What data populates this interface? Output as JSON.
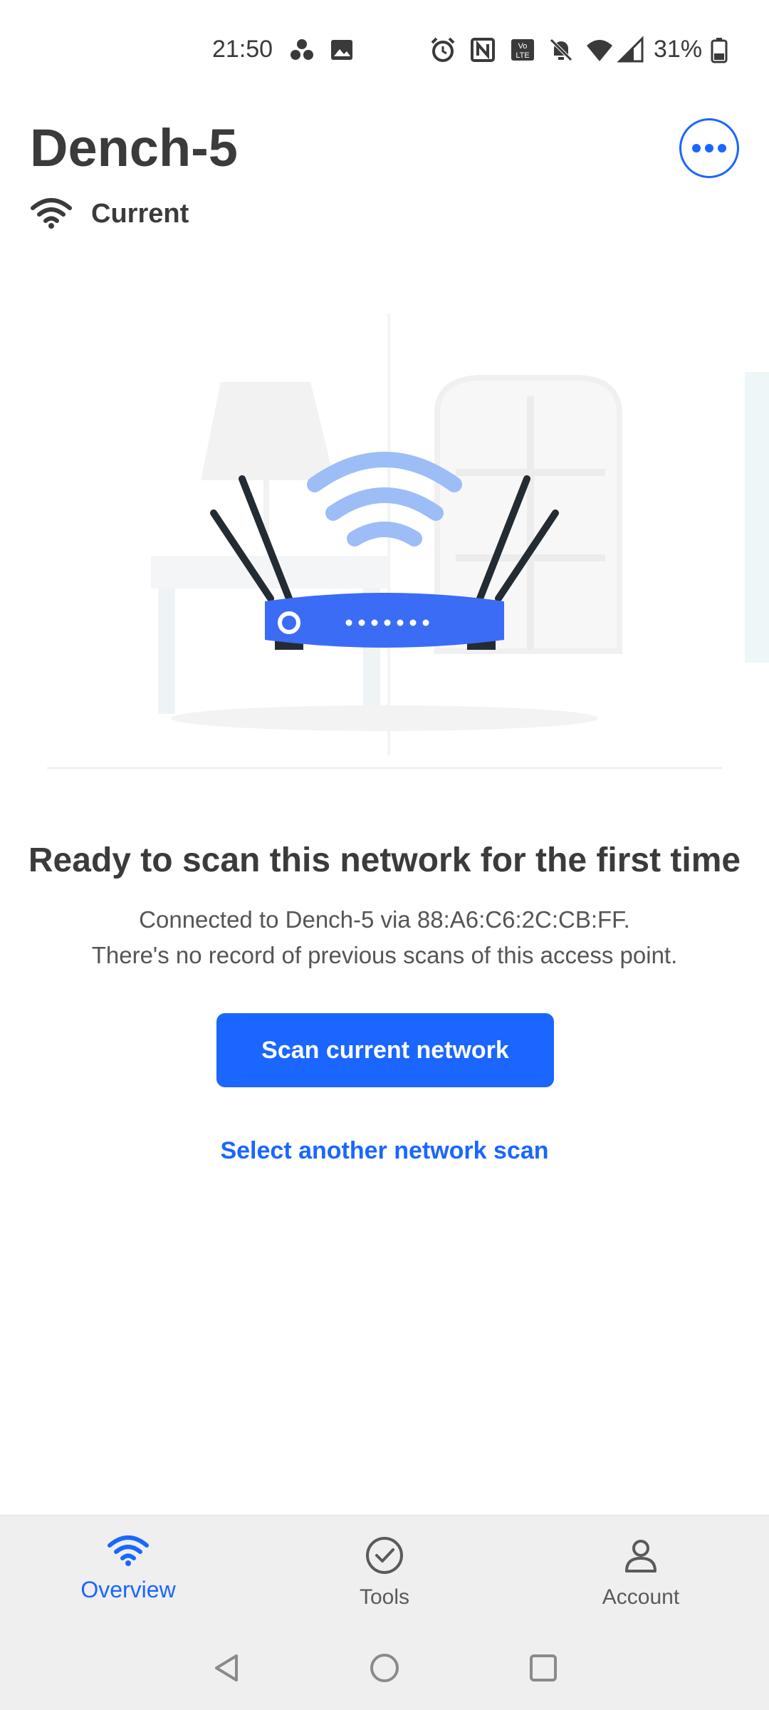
{
  "status_bar": {
    "time": "21:50",
    "battery": "31%",
    "icons": [
      "people-icon",
      "image-icon",
      "alarm-icon",
      "nfc-icon",
      "volte-icon",
      "mute-icon",
      "wifi-icon",
      "signal-icon",
      "battery-icon"
    ]
  },
  "header": {
    "title": "Dench-5",
    "status_label": "Current",
    "menu_icon": "more-horizontal-icon"
  },
  "content": {
    "headline": "Ready to scan this network for the first time",
    "description_line1": "Connected to Dench-5 via 88:A6:C6:2C:CB:FF.",
    "description_line2": "There's no record of previous scans of this access point.",
    "primary_button": "Scan current network",
    "secondary_link": "Select another network scan"
  },
  "bottom_nav": {
    "items": [
      {
        "label": "Overview",
        "icon": "wifi-icon",
        "active": true
      },
      {
        "label": "Tools",
        "icon": "check-circle-icon",
        "active": false
      },
      {
        "label": "Account",
        "icon": "person-icon",
        "active": false
      }
    ]
  },
  "system_nav": {
    "icons": [
      "back-icon",
      "home-icon",
      "recents-icon"
    ]
  },
  "colors": {
    "accent": "#1a66ff",
    "router_body": "#3b6cf5",
    "wifi_waves": "#9dbdf7",
    "nav_background": "#efefef"
  }
}
